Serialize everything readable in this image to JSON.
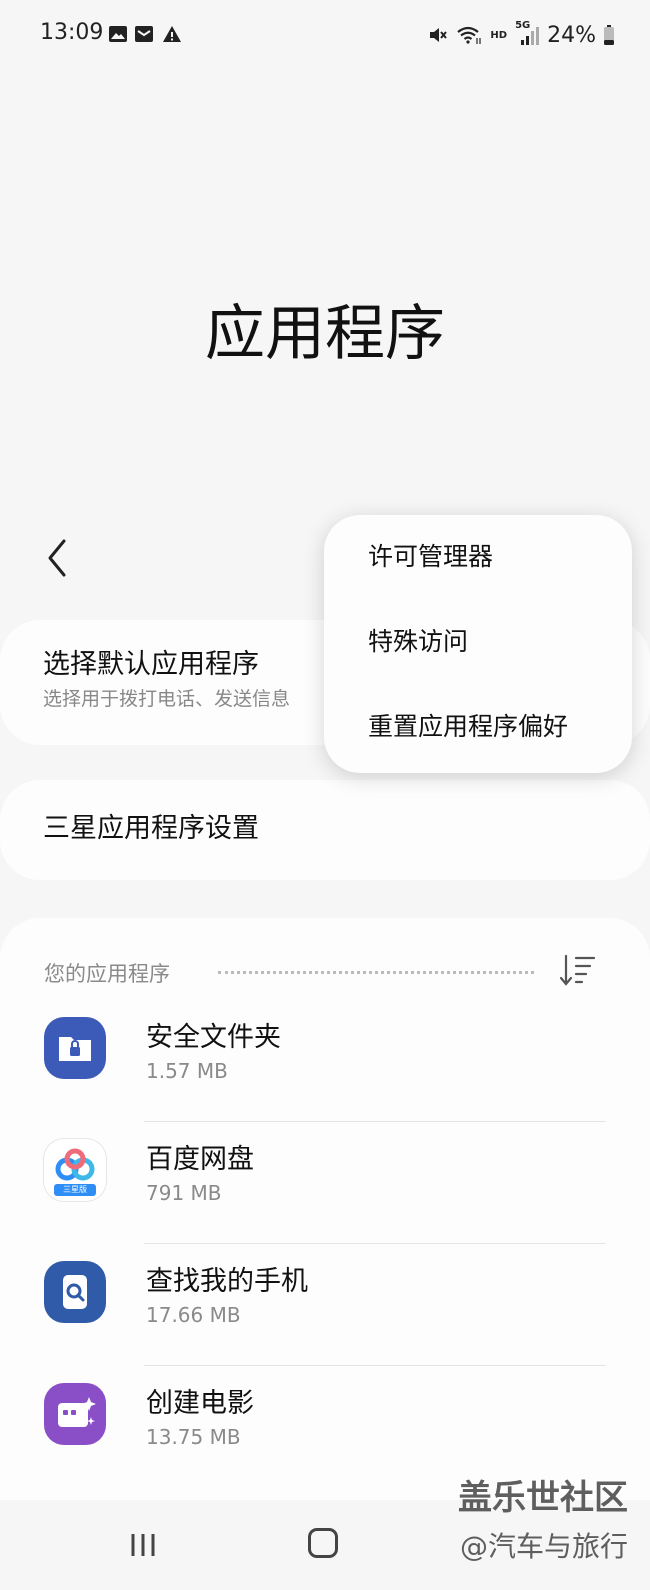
{
  "status_bar": {
    "time": "13:09",
    "battery": "24%",
    "network_hd": "HD",
    "network_5g": "5G",
    "icons": [
      "gallery-icon",
      "mail-icon",
      "warning-icon",
      "mute-icon",
      "wifi-icon",
      "signal-icon",
      "battery-icon"
    ]
  },
  "page": {
    "title": "应用程序"
  },
  "default_apps": {
    "title": "选择默认应用程序",
    "subtitle": "选择用于拨打电话、发送信息"
  },
  "samsung_settings": {
    "title": "三星应用程序设置"
  },
  "your_apps": {
    "label": "您的应用程序",
    "apps": [
      {
        "name": "安全文件夹",
        "size": "1.57 MB",
        "icon": "secure-folder-icon"
      },
      {
        "name": "百度网盘",
        "size": "791 MB",
        "icon": "baidu-netdisk-icon",
        "badge": "三星版"
      },
      {
        "name": "查找我的手机",
        "size": "17.66 MB",
        "icon": "find-my-mobile-icon"
      },
      {
        "name": "创建电影",
        "size": "13.75 MB",
        "icon": "create-movie-icon"
      }
    ]
  },
  "overflow_menu": {
    "items": [
      "许可管理器",
      "特殊访问",
      "重置应用程序偏好"
    ]
  },
  "watermark": {
    "line1": "盖乐世社区",
    "line2": "@汽车与旅行"
  },
  "colors": {
    "secure_folder": "#3c5bb8",
    "baidu_blue": "#2f8ef5",
    "find_my_mobile": "#2f5ba8",
    "create_movie": "#8a4ec6"
  }
}
